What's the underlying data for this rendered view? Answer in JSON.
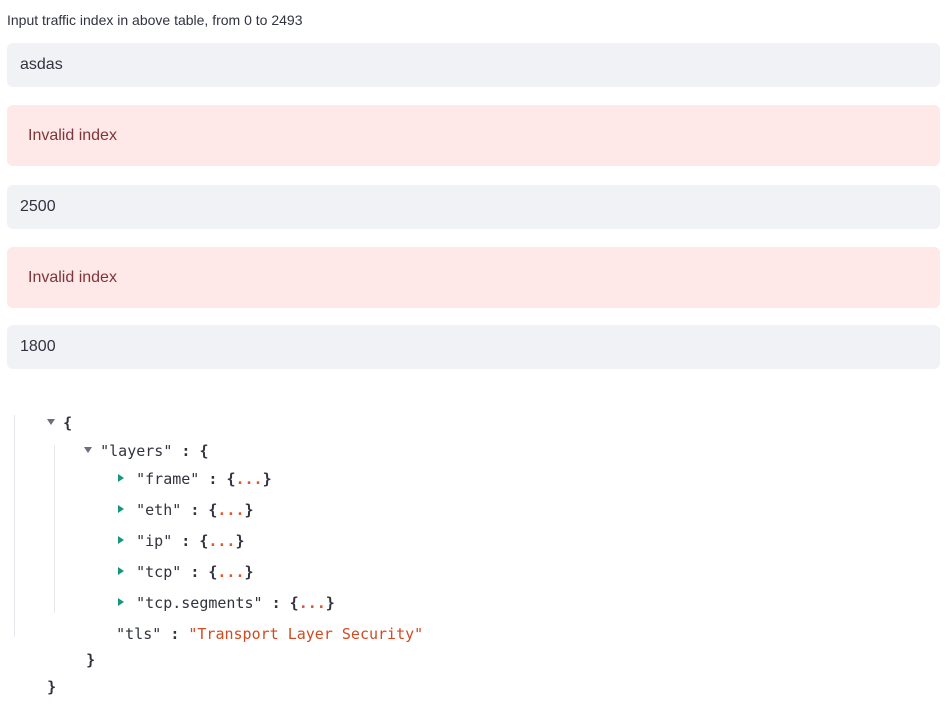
{
  "label": "Input traffic index in above table, from 0 to 2493",
  "inputs": [
    {
      "value": "asdas"
    },
    {
      "value": "2500"
    },
    {
      "value": "1800"
    }
  ],
  "alerts": [
    {
      "text": "Invalid index"
    },
    {
      "text": "Invalid index"
    }
  ],
  "json_view": {
    "open_brace": "{",
    "close_brace": "}",
    "layers_key": "\"layers\"",
    "colon": ":",
    "collapsed_dots": "...",
    "children": [
      {
        "key": "\"frame\""
      },
      {
        "key": "\"eth\""
      },
      {
        "key": "\"ip\""
      },
      {
        "key": "\"tcp\""
      },
      {
        "key": "\"tcp.segments\""
      }
    ],
    "tls_key": "\"tls\"",
    "tls_value": "\"Transport Layer Security\""
  },
  "colors": {
    "input_bg": "#f0f2f6",
    "alert_bg": "#ffe8e8",
    "alert_text": "#7d353b",
    "string_value": "#d14a20",
    "expand_arrow": "#16967d"
  }
}
